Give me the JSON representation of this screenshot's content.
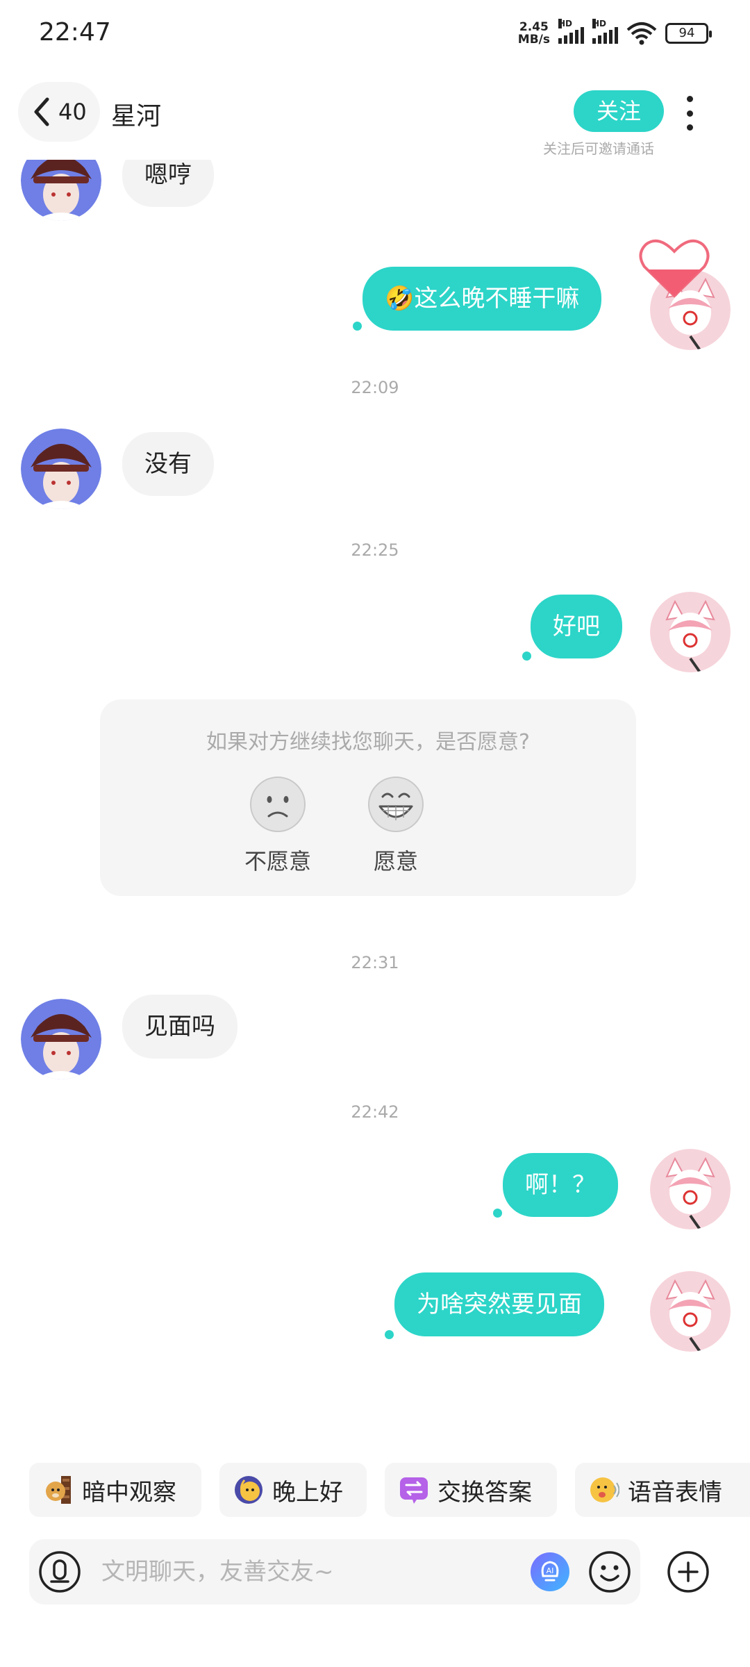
{
  "status_bar": {
    "time": "22:47",
    "net_speed_value": "2.45",
    "net_speed_unit": "MB/s",
    "signal_badge": "HD",
    "battery": "94"
  },
  "header": {
    "unread_count": "40",
    "title": "星河",
    "follow_label": "关注",
    "follow_hint": "关注后可邀请通话"
  },
  "messages": {
    "m1": "嗯哼",
    "m2": "🤣这么晚不睡干嘛",
    "t1": "22:09",
    "m3": "没有",
    "t2": "22:25",
    "m4": "好吧",
    "t3": "22:31",
    "m5": "见面吗",
    "t4": "22:42",
    "m6": "啊！？",
    "m7": "为啥突然要见面"
  },
  "prompt": {
    "question": "如果对方继续找您聊天，是否愿意?",
    "decline_label": "不愿意",
    "accept_label": "愿意"
  },
  "quick_chips": [
    {
      "label": "暗中观察",
      "icon": "doge-peek-icon"
    },
    {
      "label": "晚上好",
      "icon": "moon-face-icon"
    },
    {
      "label": "交换答案",
      "icon": "exchange-icon"
    },
    {
      "label": "语音表情",
      "icon": "voice-emoji-icon"
    }
  ],
  "input": {
    "placeholder": "文明聊天，友善交友~"
  },
  "colors": {
    "accent": "#2cd5c8",
    "bubble_left": "#f3f3f3",
    "muted_text": "#aaaaaa"
  }
}
